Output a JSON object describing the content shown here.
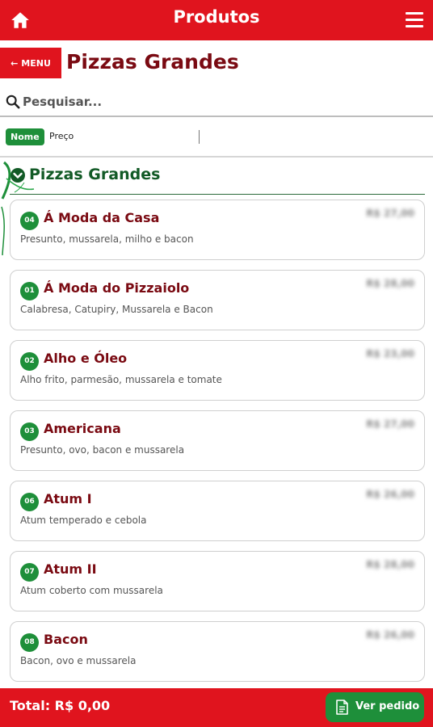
{
  "header": {
    "title": "Produtos",
    "home_icon": "home-icon",
    "menu_icon": "hamburger-menu-icon"
  },
  "subheader": {
    "back_label": "MENU",
    "page_title": "Pizzas Grandes"
  },
  "search": {
    "placeholder": "Pesquisar...",
    "value": ""
  },
  "sort": {
    "options": [
      "Nome",
      "Preço"
    ],
    "active": "Nome"
  },
  "section": {
    "title": "Pizzas Grandes"
  },
  "products": [
    {
      "num": "04",
      "name": "Á Moda da Casa",
      "desc": "Presunto, mussarela, milho e bacon",
      "price": "R$ 27,00"
    },
    {
      "num": "01",
      "name": "Á Moda do Pizzaiolo",
      "desc": "Calabresa, Catupiry, Mussarela e Bacon",
      "price": "R$ 28,00"
    },
    {
      "num": "02",
      "name": "Alho e Óleo",
      "desc": "Alho frito, parmesão, mussarela e tomate",
      "price": "R$ 23,00"
    },
    {
      "num": "03",
      "name": "Americana",
      "desc": "Presunto, ovo, bacon e mussarela",
      "price": "R$ 27,00"
    },
    {
      "num": "06",
      "name": "Atum I",
      "desc": "Atum temperado e cebola",
      "price": "R$ 26,00"
    },
    {
      "num": "07",
      "name": "Atum II",
      "desc": "Atum coberto com mussarela",
      "price": "R$ 28,00"
    },
    {
      "num": "08",
      "name": "Bacon",
      "desc": "Bacon, ovo e mussarela",
      "price": "R$ 26,00"
    }
  ],
  "footer": {
    "total": "Total: R$ 0,00",
    "button_label": "Ver pedido"
  },
  "colors": {
    "brand_red": "#e0141e",
    "accent_green": "#1e8f3a",
    "title_maroon": "#7a0a12"
  }
}
